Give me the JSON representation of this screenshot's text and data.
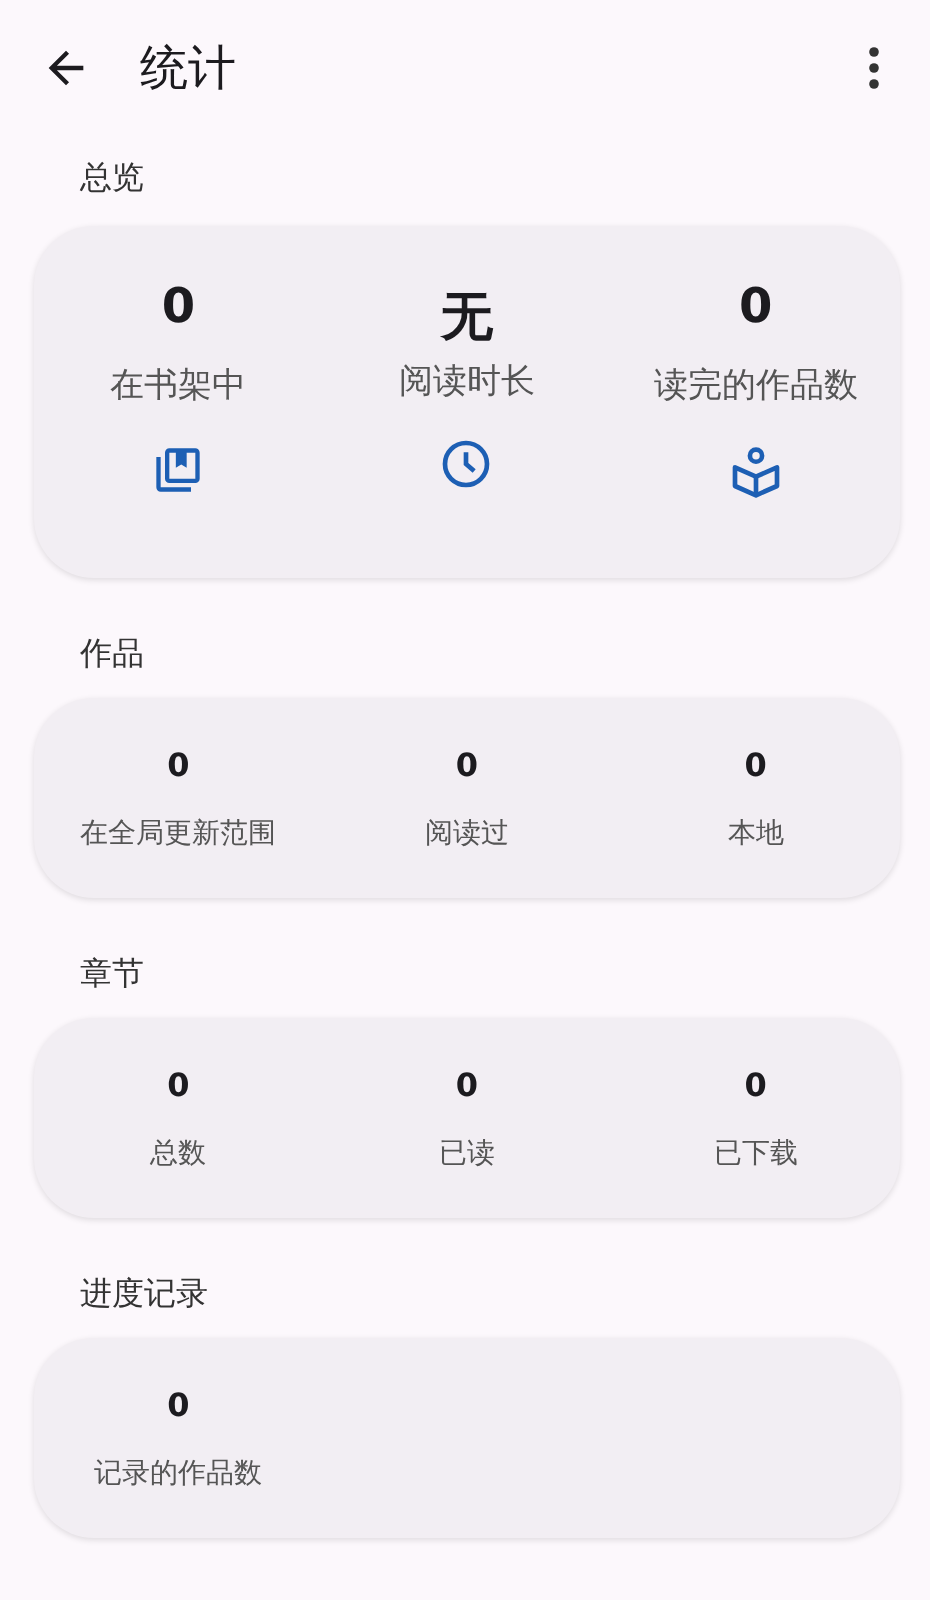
{
  "app_bar": {
    "title": "统计"
  },
  "overview": {
    "heading": "总览",
    "stats": [
      {
        "value": "0",
        "label": "在书架中"
      },
      {
        "value": "无",
        "label": "阅读时长"
      },
      {
        "value": "0",
        "label": "读完的作品数"
      }
    ]
  },
  "sections": [
    {
      "heading": "作品",
      "stats": [
        {
          "value": "0",
          "label": "在全局更新范围"
        },
        {
          "value": "0",
          "label": "阅读过"
        },
        {
          "value": "0",
          "label": "本地"
        }
      ]
    },
    {
      "heading": "章节",
      "stats": [
        {
          "value": "0",
          "label": "总数"
        },
        {
          "value": "0",
          "label": "已读"
        },
        {
          "value": "0",
          "label": "已下载"
        }
      ]
    },
    {
      "heading": "进度记录",
      "stats": [
        {
          "value": "0",
          "label": "记录的作品数"
        }
      ]
    }
  ]
}
